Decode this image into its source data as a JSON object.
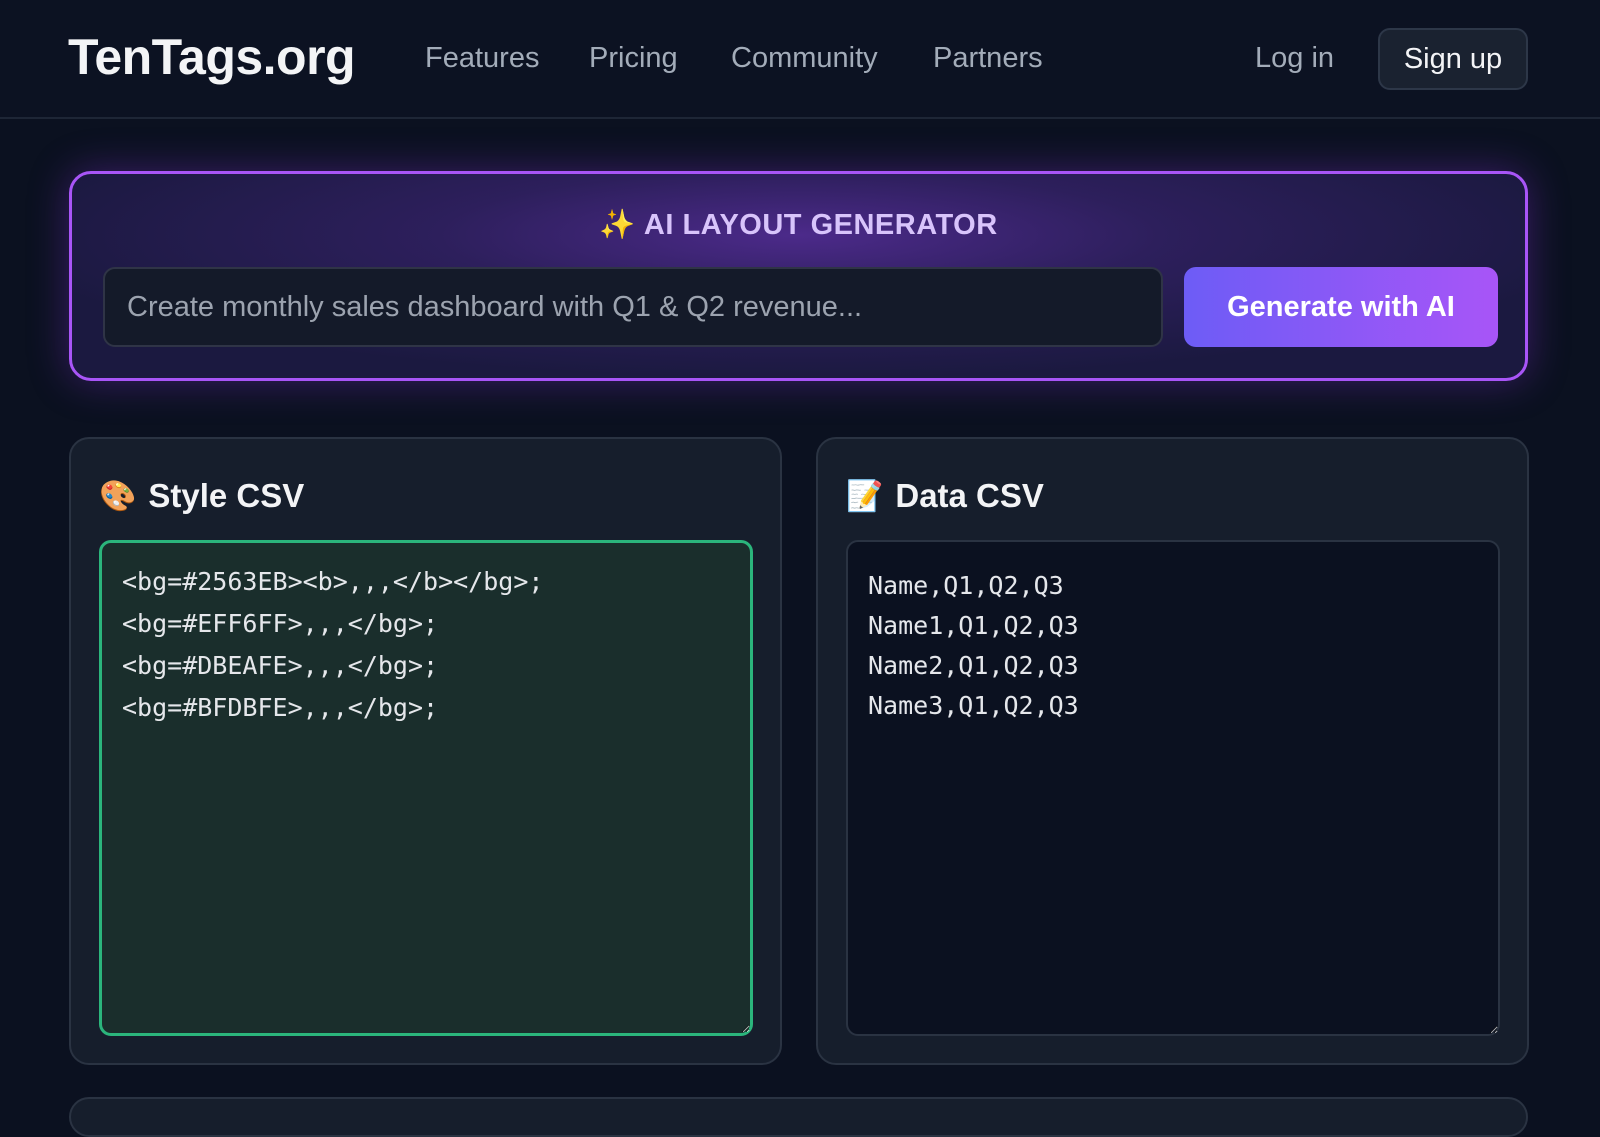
{
  "header": {
    "logo": "TenTags.org",
    "nav": [
      "Features",
      "Pricing",
      "Community",
      "Partners"
    ],
    "login_label": "Log in",
    "signup_label": "Sign up"
  },
  "ai_generator": {
    "icon": "sparkles-icon",
    "title": "AI LAYOUT GENERATOR",
    "prompt_placeholder": "Create monthly sales dashboard with Q1 & Q2 revenue...",
    "prompt_value": "",
    "button_label": "Generate with AI",
    "colors": {
      "border": "#a855f7",
      "button_start": "#6d5cf6",
      "button_end": "#a855f7"
    }
  },
  "style_csv": {
    "icon": "palette-icon",
    "title": "Style CSV",
    "content": "<bg=#2563EB><b>,,,</b></bg>;\n<bg=#EFF6FF>,,,</bg>;\n<bg=#DBEAFE>,,,</bg>;\n<bg=#BFDBFE>,,,</bg>;",
    "focus_color": "#2bb57c"
  },
  "data_csv": {
    "icon": "memo-icon",
    "title": "Data CSV",
    "content": "Name,Q1,Q2,Q3\nName1,Q1,Q2,Q3\nName2,Q1,Q2,Q3\nName3,Q1,Q2,Q3"
  }
}
